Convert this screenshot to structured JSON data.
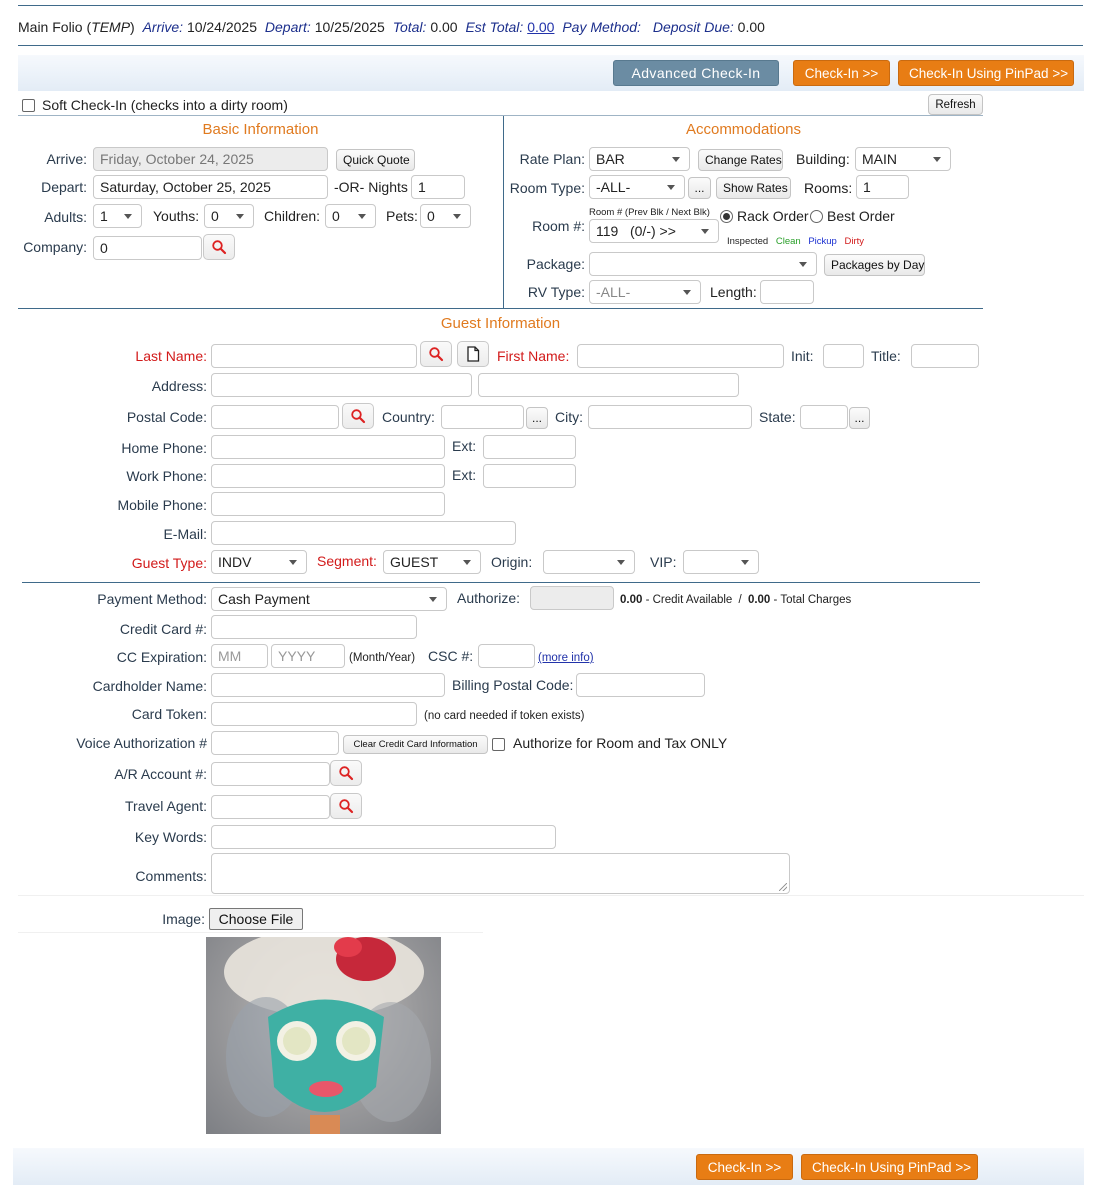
{
  "folio": {
    "name": "Main Folio (",
    "status": "TEMP",
    "close_paren": ")",
    "arrive_label": "Arrive:",
    "arrive_value": "10/24/2025",
    "depart_label": "Depart:",
    "depart_value": "10/25/2025",
    "total_label": "Total:",
    "total_value": "0.00",
    "est_total_label": "Est Total:",
    "est_total_value": "0.00",
    "pay_method_label": "Pay Method:",
    "deposit_label": "Deposit Due:",
    "deposit_value": "0.00"
  },
  "top_actions": {
    "advanced_checkin": "Advanced Check-In",
    "checkin": "Check-In >>",
    "checkin_pinpad": "Check-In Using PinPad >>"
  },
  "soft_checkin": {
    "label": "Soft Check-In (checks into a dirty room)",
    "checked": false
  },
  "refresh_label": "Refresh",
  "basic": {
    "title": "Basic Information",
    "arrive_label": "Arrive:",
    "arrive_value": "Friday, October 24, 2025",
    "quick_quote": "Quick Quote",
    "depart_label": "Depart:",
    "depart_value": "Saturday, October 25, 2025",
    "nights_label": "-OR- Nights",
    "nights_value": "1",
    "adults_label": "Adults:",
    "adults_value": "1",
    "youths_label": "Youths:",
    "youths_value": "0",
    "children_label": "Children:",
    "children_value": "0",
    "pets_label": "Pets:",
    "pets_value": "0",
    "company_label": "Company:",
    "company_value": "0"
  },
  "accom": {
    "title": "Accommodations",
    "rate_plan_label": "Rate Plan:",
    "rate_plan_value": "BAR",
    "change_rates": "Change Rates",
    "building_label": "Building:",
    "building_value": "MAIN",
    "room_type_label": "Room Type:",
    "room_type_value": "-ALL-",
    "dots": "...",
    "show_rates": "Show Rates",
    "rooms_label": "Rooms:",
    "rooms_value": "1",
    "room_no_label": "Room #:",
    "room_hint": "Room # (Prev Blk / Next Blk)",
    "room_value": "119   (0/-) >>",
    "rack_order": "Rack Order",
    "best_order": "Best Order",
    "legend_inspected": "Inspected",
    "legend_clean": "Clean",
    "legend_pickup": "Pickup",
    "legend_dirty": "Dirty",
    "package_label": "Package:",
    "package_value": "",
    "packages_by_day": "Packages by Day",
    "rv_type_label": "RV Type:",
    "rv_type_value": "-ALL-",
    "length_label": "Length:",
    "length_value": ""
  },
  "guest": {
    "title": "Guest Information",
    "last_name_label": "Last Name:",
    "first_name_label": "First Name:",
    "init_label": "Init:",
    "title_label": "Title:",
    "address_label": "Address:",
    "postal_label": "Postal Code:",
    "country_label": "Country:",
    "city_label": "City:",
    "state_label": "State:",
    "home_phone_label": "Home Phone:",
    "work_phone_label": "Work Phone:",
    "ext_label": "Ext:",
    "mobile_label": "Mobile Phone:",
    "email_label": "E-Mail:",
    "guest_type_label": "Guest Type:",
    "guest_type_value": "INDV",
    "segment_label": "Segment:",
    "segment_value": "GUEST",
    "origin_label": "Origin:",
    "origin_value": "",
    "vip_label": "VIP:",
    "vip_value": "",
    "dots": "..."
  },
  "payment": {
    "method_label": "Payment Method:",
    "method_value": "Cash Payment",
    "authorize_label": "Authorize:",
    "credit_available_value": "0.00",
    "credit_available_label": "- Credit Available",
    "slash": "/",
    "total_charges_value": "0.00",
    "total_charges_label": "- Total Charges",
    "cc_label": "Credit Card #:",
    "cc_exp_label": "CC Expiration:",
    "mm_placeholder": "MM",
    "yyyy_placeholder": "YYYY",
    "month_year": "(Month/Year)",
    "csc_label": "CSC #:",
    "more_info": "(more info)",
    "cardholder_label": "Cardholder Name:",
    "billing_postal_label": "Billing Postal Code:",
    "card_token_label": "Card Token:",
    "no_card_needed": "(no card needed if token exists)",
    "voice_auth_label": "Voice Authorization #",
    "clear_cc": "Clear Credit Card Information",
    "auth_room_tax": "Authorize for Room and Tax ONLY",
    "ar_account_label": "A/R Account #:",
    "travel_agent_label": "Travel Agent:",
    "key_words_label": "Key Words:",
    "comments_label": "Comments:",
    "image_label": "Image:",
    "choose_file": "Choose File"
  },
  "bottom_actions": {
    "checkin": "Check-In >>",
    "checkin_pinpad": "Check-In Using PinPad >>"
  },
  "colors": {
    "accent_orange": "#e87d14",
    "steel_blue": "#6b8ca3",
    "required_red": "#d21a1a",
    "label_navy": "#2a3b4d",
    "legend_clean": "#2aa02a",
    "legend_pickup": "#1a2fd0",
    "legend_dirty": "#d21a1a"
  }
}
